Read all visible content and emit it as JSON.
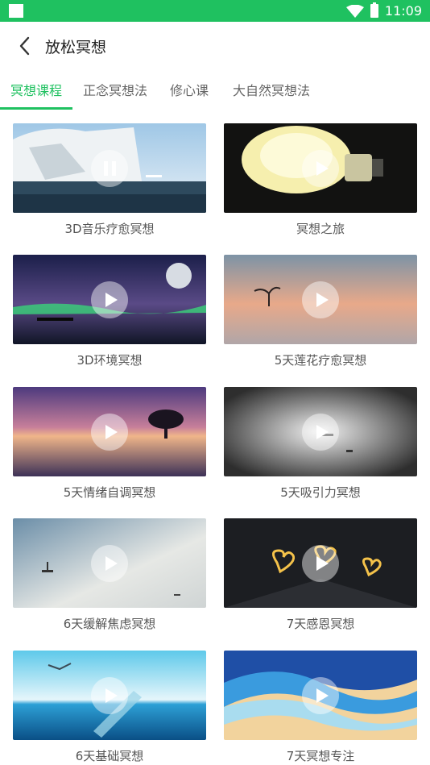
{
  "status_bar": {
    "time": "11:09",
    "background": "#1fc160"
  },
  "header": {
    "title": "放松冥想",
    "back_icon": "chevron-left-icon"
  },
  "tabs": [
    {
      "label": "冥想课程",
      "active": true
    },
    {
      "label": "正念冥想法",
      "active": false
    },
    {
      "label": "修心课",
      "active": false
    },
    {
      "label": "大自然冥想法",
      "active": false
    }
  ],
  "accent_color": "#1fc160",
  "courses": [
    {
      "title": "3D音乐疗愈冥想",
      "state": "paused"
    },
    {
      "title": "冥想之旅",
      "state": "play"
    },
    {
      "title": "3D环境冥想",
      "state": "play"
    },
    {
      "title": "5天莲花疗愈冥想",
      "state": "play"
    },
    {
      "title": "5天情绪自调冥想",
      "state": "play"
    },
    {
      "title": "5天吸引力冥想",
      "state": "play"
    },
    {
      "title": "6天缓解焦虑冥想",
      "state": "play"
    },
    {
      "title": "7天感恩冥想",
      "state": "play"
    },
    {
      "title": "6天基础冥想",
      "state": "play"
    },
    {
      "title": "7天冥想专注",
      "state": "play"
    }
  ]
}
